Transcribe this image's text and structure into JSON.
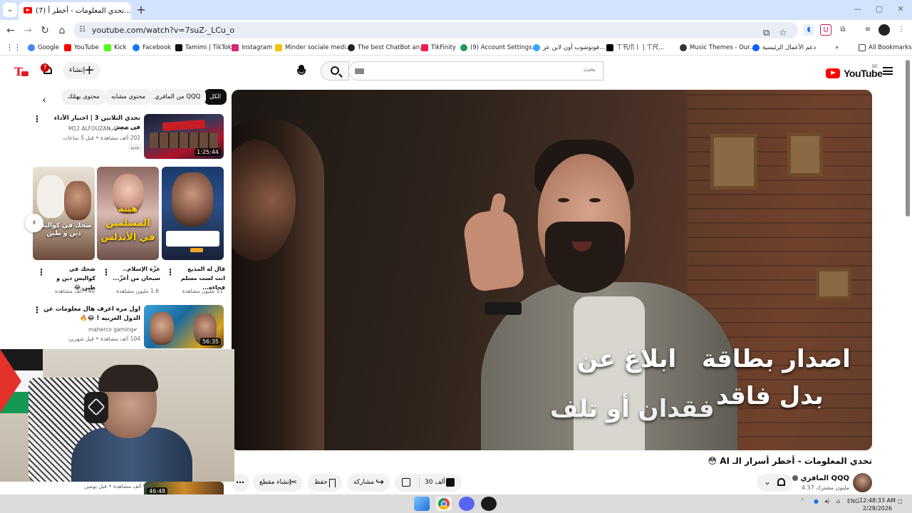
{
  "browser": {
    "tab_title": "(7) تحدي المعلومات - أخطر أ...",
    "tab_close": "✕",
    "new_tab": "+",
    "url": "youtube.com/watch?v=7suZ-_LCu_o",
    "bookmarks": [
      {
        "label": "Google",
        "color": "#4285f4"
      },
      {
        "label": "YouTube",
        "color": "#ff0000"
      },
      {
        "label": "Kick",
        "color": "#53fc18"
      },
      {
        "label": "Facebook",
        "color": "#1877f2"
      },
      {
        "label": "Tamimi | TikTok",
        "color": "#111111"
      },
      {
        "label": "Instagram",
        "color": "#d62976"
      },
      {
        "label": "Minder sociale medi...",
        "color": "#f4c20d"
      },
      {
        "label": "The best ChatBot an...",
        "color": "#222222"
      },
      {
        "label": "TikFinity",
        "color": "#ee1d52"
      },
      {
        "label": "(9) Account Settings...",
        "color": "#1d9b5a"
      },
      {
        "label": "فوتوشوب أون لاين عز...",
        "color": "#31a8ff"
      },
      {
        "label": "ㄒ卂爪丨 | ㄒ尺...",
        "color": "#000000"
      },
      {
        "label": "Music Themes - Our...",
        "color": "#333333"
      },
      {
        "label": "دعم الأعمال الرئيسية",
        "color": "#0866ff"
      }
    ],
    "all_bookmarks": "All Bookmarks"
  },
  "youtube": {
    "logo_text": "YouTube",
    "country_code": "BE",
    "search_placeholder": "بحث",
    "create_label": "إنشاء",
    "notification_count": "7"
  },
  "chips": [
    {
      "label": "الكل",
      "active": true
    },
    {
      "label": "من المافري QQQ",
      "active": false
    },
    {
      "label": "محتوى مشابه",
      "active": false
    },
    {
      "label": "محتوى يهمّك",
      "active": false
    }
  ],
  "sidebar": {
    "video1": {
      "title": "تحدي التلاتين 3 | اختبار الأداء في مصر",
      "channel": "M12 ALFOUZAN",
      "channel_note": "قدم الكرة",
      "meta": "202 ألف مشاهدة • قبل 5 ساعات",
      "badge": "جديد",
      "duration": "1:25:44"
    },
    "shorts": [
      {
        "title": "قال له المذيع انت لست مسلم فجاءه...",
        "views": "11 مليون مشاهدة",
        "overlay": ""
      },
      {
        "title": "عزّة الإسلام.. سبحان من أعزّ...",
        "views": "1.6 مليون مشاهدة",
        "overlay": "هيبة المسلمين في الأندلس"
      },
      {
        "title": "ضحك في كواليس دين و طين 😂",
        "views": "740 ألف مشاهدة",
        "overlay": "ضحك في كواليس دين و طين"
      }
    ],
    "video2": {
      "title": "اول مره اعرف هال معلومات عن الدول العربيه ! 😂🔥",
      "channel": "maherco gaming",
      "meta": "104 ألف مشاهدة • قبل شهرين",
      "duration": "56:35"
    },
    "video3": {
      "meta": "945 ألف مشاهدة • قبل يومين",
      "duration": "46:48"
    }
  },
  "video": {
    "captions": [
      "اصدار بطاقة",
      "ابلاغ عن",
      "بدل فاقد",
      "فقدان أو تلف"
    ],
    "title": "تحدي المعلومات - أخطر أسرار الـ AI 😳",
    "channel": "المافري QQQ",
    "subscribers": "4.37 مليون مشترك",
    "likes": "30 ألف",
    "share": "مشاركة",
    "save": "حفظ",
    "clip": "إنشاء مقطع"
  },
  "taskbar": {
    "lang": "ENG",
    "time": "12:48:33 AM",
    "date": "2/28/2026"
  },
  "colors": {
    "brand_red": "#ff0000",
    "chrome_tabstrip": "#d3e3fd"
  }
}
